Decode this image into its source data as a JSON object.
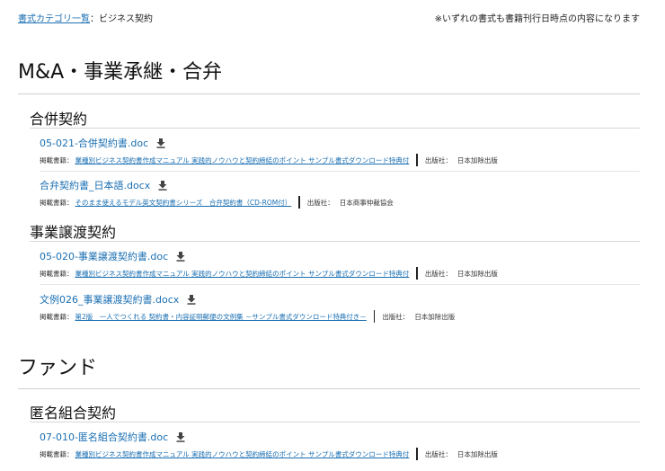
{
  "breadcrumb": {
    "link": "書式カテゴリ一覧",
    "separator": "：",
    "current": "ビジネス契約"
  },
  "notice": "※いずれの書式も書籍刊行日時点の内容になります",
  "labels": {
    "book_prefix": "掲載書籍：",
    "publisher_prefix": "出版社："
  },
  "sections": [
    {
      "title": "M&A・事業承継・合弁",
      "groups": [
        {
          "title": "合併契約",
          "entries": [
            {
              "file": "05-021-合併契約書.doc",
              "book": "業種別ビジネス契約書作成マニュアル 実践的ノウハウと契約締結のポイント サンプル書式ダウンロード特典付",
              "publisher": "日本加除出版"
            },
            {
              "file": "合弁契約書_日本語.docx",
              "book": "そのまま使えるモデル英文契約書シリーズ　合弁契約書（CD-ROM付）",
              "publisher": "日本商事仲裁協会"
            }
          ]
        },
        {
          "title": "事業譲渡契約",
          "entries": [
            {
              "file": "05-020-事業譲渡契約書.doc",
              "book": "業種別ビジネス契約書作成マニュアル 実践的ノウハウと契約締結のポイント サンプル書式ダウンロード特典付",
              "publisher": "日本加除出版"
            },
            {
              "file": "文例026_事業譲渡契約書.docx",
              "book": "第2版　一人でつくれる 契約書・内容証明郵便の文例集 －サンプル書式ダウンロード特典付き－",
              "publisher": "日本加除出版"
            }
          ]
        }
      ]
    },
    {
      "title": "ファンド",
      "groups": [
        {
          "title": "匿名組合契約",
          "entries": [
            {
              "file": "07-010-匿名組合契約書.doc",
              "book": "業種別ビジネス契約書作成マニュアル 実践的ノウハウと契約締結のポイント サンプル書式ダウンロード特典付",
              "publisher": "日本加除出版"
            }
          ]
        }
      ]
    }
  ]
}
